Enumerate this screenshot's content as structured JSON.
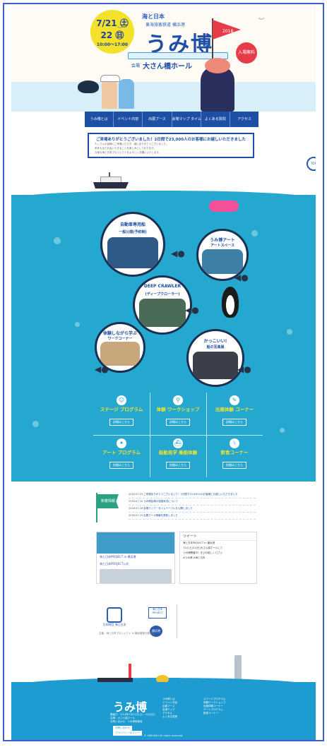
{
  "header": {
    "date_line1": "7/21 ㊏",
    "date_line2": "22 ㊐",
    "time": "10:00〜17:00",
    "brand": "海と日本",
    "brand_sub": "東海旅客鉄道 横浜港",
    "title": "うみ博",
    "year": "2018",
    "free_badge": "入場無料",
    "venue_label": "会場",
    "venue": "大さん橋ホール",
    "ribbon_text": ""
  },
  "nav": {
    "items": [
      "うみ博とは",
      "イベント内容",
      "出展ブース",
      "会場マップ タイムテーブル",
      "よくある質問",
      "アクセス"
    ]
  },
  "notice": {
    "headline": "ご来場ありがとうございました！2日間で23,000人のお客様にお越しいただきました",
    "lines": [
      "たくさんの皆様にご来場いただき、誠にありがとうございました。",
      "来年もまたお会いできることを楽しみにしております。",
      "今後も海と日本プロジェクトをよろしくお願いいたします。"
    ]
  },
  "float_button": "TOP",
  "exhibits": [
    {
      "caption": "自動車専用船",
      "caption2": "一般公開(予約制)"
    },
    {
      "caption": "うみ博アート",
      "caption2": "アートスペース"
    },
    {
      "caption": "DEEP CRAWLER",
      "caption2": "(ディープクローラー)"
    },
    {
      "caption": "体験しながら学ぶ",
      "caption2": "ワークコーナー"
    },
    {
      "caption": "かっこいい!",
      "caption2": "船の写真展"
    }
  ],
  "corners": [
    {
      "icon": "☺",
      "label": "ステージ プログラム",
      "more": "詳細はこちら"
    },
    {
      "icon": "⚲",
      "label": "体験 ワークショップ",
      "more": "詳細はこちら"
    },
    {
      "icon": "✎",
      "label": "出展体験 コーナー",
      "more": "詳細はこちら"
    },
    {
      "icon": "✦",
      "label": "アート プログラム",
      "more": "詳細はこちら"
    },
    {
      "icon": "⛴",
      "label": "船舶見学 乗船体験",
      "more": "詳細はこちら"
    },
    {
      "icon": "⑊",
      "label": "飲食コーナー",
      "more": "詳細はこちら"
    }
  ],
  "news": {
    "flag": "新着情報",
    "items": [
      {
        "date": "2018.07.23",
        "text": "ご来場ありがとうございました！2日間で23,000人のお客様にお越しいただきました"
      },
      {
        "date": "2018.07.20",
        "text": "うみ博会場の混雑状況について"
      },
      {
        "date": "2018.07.18",
        "text": "会場マップ・タイムテーブルを公開しました"
      },
      {
        "date": "2018.07.10",
        "text": "出展ブース情報を更新しました"
      }
    ]
  },
  "facebook": {
    "label": "海と日本PROJECT in 横浜港",
    "post": "海と日本PROJECT公式"
  },
  "twitter": {
    "header": "ツイート",
    "lines": [
      "海と日本PROJECT in 横浜港",
      "7/21(土)22(日)大さん橋ホールにて",
      "うみ博開催中！ぜひお越しください",
      "#うみ博 #海と日本"
    ]
  },
  "sponsors": {
    "left_name": "日本財団 海と日本",
    "right1": "海と日本 PROJECT",
    "right2": "横浜港",
    "note": "主催：海と日本プロジェクト in 横浜港実行委員会"
  },
  "footer": {
    "logo": "うみ博",
    "info": [
      "開催日：2018年7月21日(土)・22日(日)",
      "会場：大さん橋ホール",
      "お問い合わせ：うみ博事務局"
    ],
    "btn1": "お問い合わせ",
    "btn2": "プライバシーポリシー",
    "col1": [
      "うみ博とは",
      "イベント内容",
      "出展ブース",
      "会場マップ",
      "アクセス",
      "よくある質問"
    ],
    "col2": [
      "ステージプログラム",
      "体験ワークショップ",
      "出展体験コーナー",
      "アートプログラム",
      "飲食コーナー"
    ],
    "copyright": "© UMIHAKU All rights reserved."
  },
  "colors": {
    "sea": "#24a8cf",
    "navy": "#1d4fa6",
    "accent_yellow": "#f6e22e",
    "accent_red": "#e63c48"
  }
}
